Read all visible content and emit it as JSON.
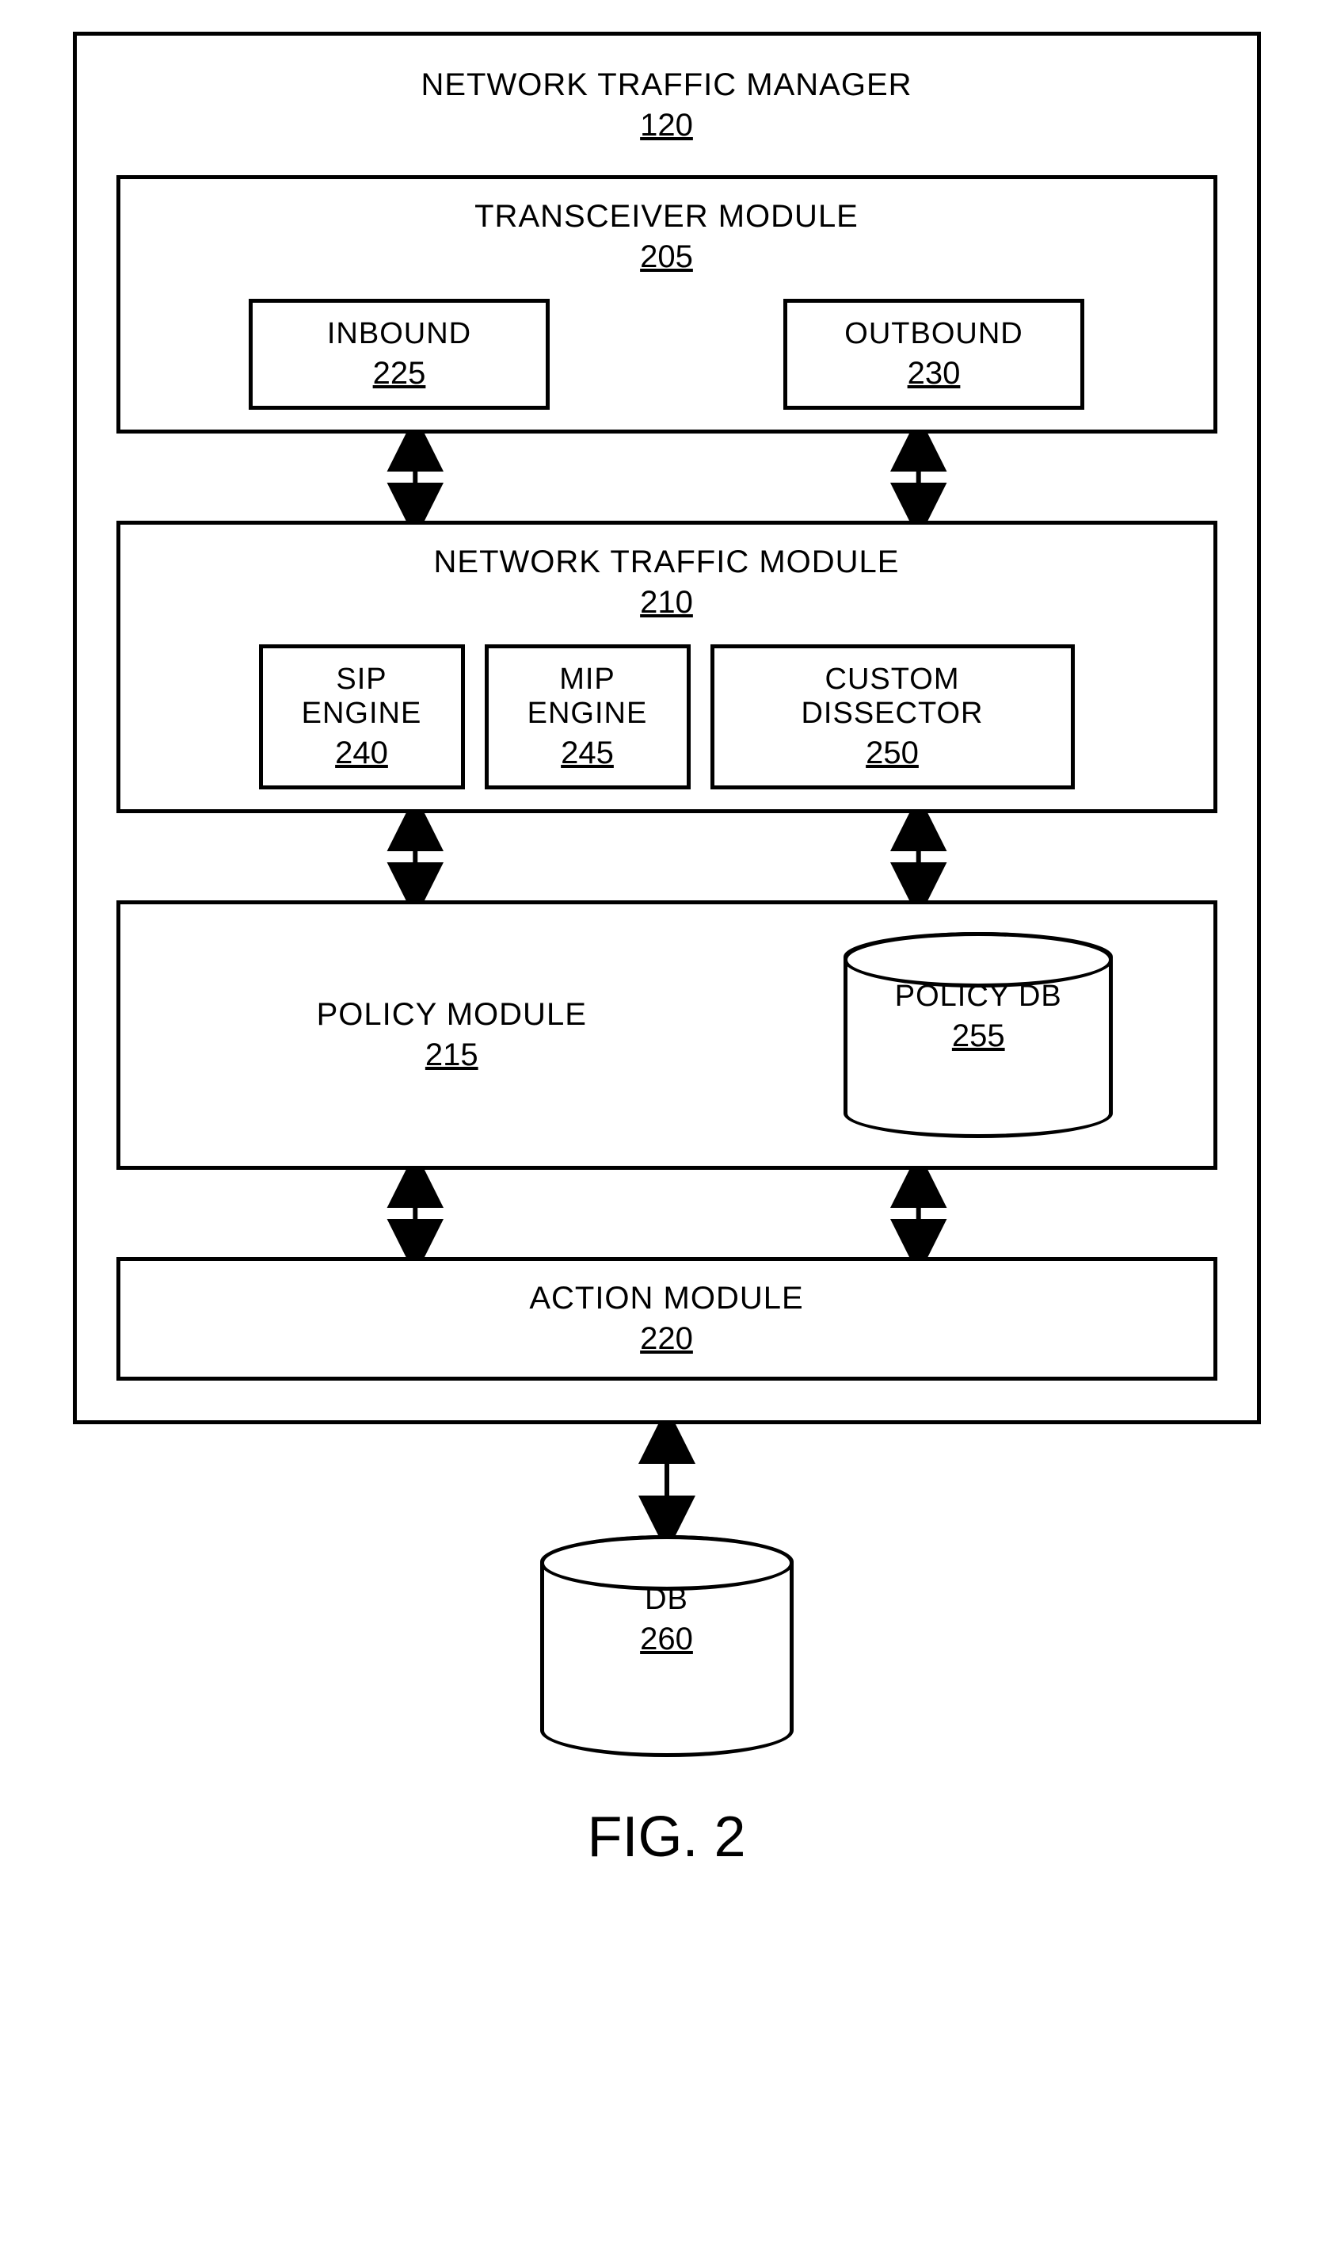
{
  "diagram": {
    "outer": {
      "title": "NETWORK TRAFFIC MANAGER",
      "ref": "120"
    },
    "transceiver": {
      "title": "TRANSCEIVER MODULE",
      "ref": "205",
      "inbound": {
        "label": "INBOUND",
        "ref": "225"
      },
      "outbound": {
        "label": "OUTBOUND",
        "ref": "230"
      }
    },
    "traffic": {
      "title": "NETWORK TRAFFIC MODULE",
      "ref": "210",
      "sip": {
        "label": "SIP\nENGINE",
        "ref": "240"
      },
      "mip": {
        "label": "MIP\nENGINE",
        "ref": "245"
      },
      "custom": {
        "label": "CUSTOM\nDISSECTOR",
        "ref": "250"
      }
    },
    "policy": {
      "title": "POLICY MODULE",
      "ref": "215",
      "db": {
        "label": "POLICY DB",
        "ref": "255"
      }
    },
    "action": {
      "title": "ACTION MODULE",
      "ref": "220"
    },
    "external_db": {
      "label": "DB",
      "ref": "260"
    },
    "figure": "FIG. 2"
  }
}
